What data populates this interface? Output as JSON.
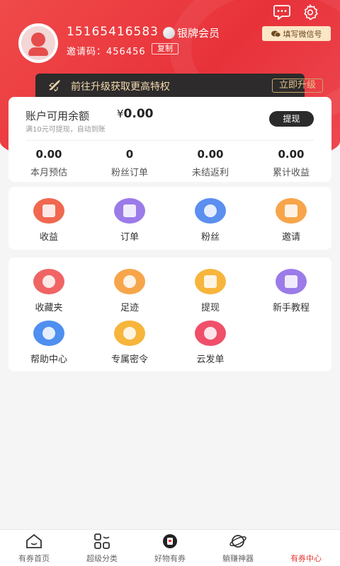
{
  "profile": {
    "phone": "15165416583",
    "member_level": "银牌会员",
    "invite_code_text": "邀请码：456456",
    "copy_label": "复制",
    "wechat_label": "填写微信号"
  },
  "vip_banner": {
    "text": "前往升级获取更高特权",
    "button": "立即升级"
  },
  "balance": {
    "label": "账户可用余额",
    "currency": "¥",
    "amount": "0.00",
    "tip": "满10元可提现，自动到账",
    "withdraw_label": "提现",
    "stats": [
      {
        "value": "0.00",
        "label": "本月预估"
      },
      {
        "value": "0",
        "label": "粉丝订单"
      },
      {
        "value": "0.00",
        "label": "未结返利"
      },
      {
        "value": "0.00",
        "label": "累计收益"
      }
    ]
  },
  "menu1": [
    {
      "label": "收益",
      "icon": "wallet-icon",
      "color": "#f0684f"
    },
    {
      "label": "订单",
      "icon": "order-icon",
      "color": "#9b7be8"
    },
    {
      "label": "粉丝",
      "icon": "fans-icon",
      "color": "#5b8ff0"
    },
    {
      "label": "邀请",
      "icon": "gift-icon",
      "color": "#f7a54a"
    }
  ],
  "menu2": [
    {
      "label": "收藏夹",
      "icon": "heart-icon",
      "color": "#f06464"
    },
    {
      "label": "足迹",
      "icon": "footprint-icon",
      "color": "#f7a54a"
    },
    {
      "label": "提现",
      "icon": "withdraw-icon",
      "color": "#f7b53c"
    },
    {
      "label": "新手教程",
      "icon": "video-icon",
      "color": "#9b7be8"
    },
    {
      "label": "帮助中心",
      "icon": "help-icon",
      "color": "#4f8ff0"
    },
    {
      "label": "专属密令",
      "icon": "key-icon",
      "color": "#f7b53c"
    },
    {
      "label": "云发单",
      "icon": "camera-icon",
      "color": "#f04f6a"
    }
  ],
  "tabbar": [
    {
      "label": "有券首页",
      "icon": "home-icon",
      "active": false
    },
    {
      "label": "超级分类",
      "icon": "category-icon",
      "active": false
    },
    {
      "label": "好物有券",
      "icon": "goods-icon",
      "active": false
    },
    {
      "label": "躺赚神器",
      "icon": "planet-icon",
      "active": false
    },
    {
      "label": "有券中心",
      "icon": "user-center-icon",
      "active": true
    }
  ],
  "colors": {
    "brand_red": "#e8323a",
    "dark": "#2b2b2b",
    "gold": "#e6c48e",
    "active_tab": "#e53935"
  }
}
